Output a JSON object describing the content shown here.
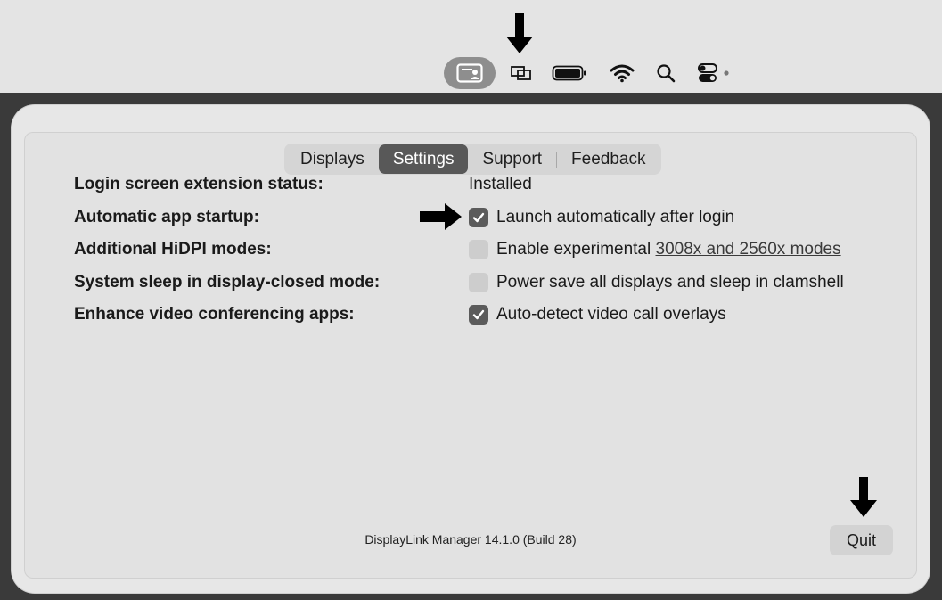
{
  "menubar": {
    "items": [
      {
        "icon": "displaylink-display-icon",
        "active": true
      },
      {
        "icon": "screen-mirroring-icon"
      },
      {
        "icon": "battery-icon"
      },
      {
        "icon": "wifi-icon"
      },
      {
        "icon": "spotlight-search-icon"
      },
      {
        "icon": "control-center-icon"
      }
    ]
  },
  "tabs": [
    {
      "label": "Displays",
      "selected": false
    },
    {
      "label": "Settings",
      "selected": true
    },
    {
      "label": "Support",
      "selected": false
    },
    {
      "label": "Feedback",
      "selected": false
    }
  ],
  "settings": {
    "login_ext": {
      "label": "Login screen extension status:",
      "value": "Installed"
    },
    "auto_start": {
      "label": "Automatic app startup:",
      "option": "Launch automatically after login",
      "checked": true
    },
    "hidpi": {
      "label": "Additional HiDPI modes:",
      "option_prefix": "Enable experimental ",
      "option_link": "3008x and 2560x modes",
      "checked": false
    },
    "sleep": {
      "label": "System sleep in display-closed mode:",
      "option": "Power save all displays and sleep in clamshell",
      "checked": false
    },
    "video": {
      "label": "Enhance video conferencing apps:",
      "option": "Auto-detect video call overlays",
      "checked": true
    }
  },
  "footer": {
    "version": "DisplayLink Manager 14.1.0 (Build 28)",
    "quit_label": "Quit"
  },
  "colors": {
    "selected_tab": "#585858",
    "checked_box": "#5b5b5b",
    "menubar_active": "#8e8e8e"
  }
}
